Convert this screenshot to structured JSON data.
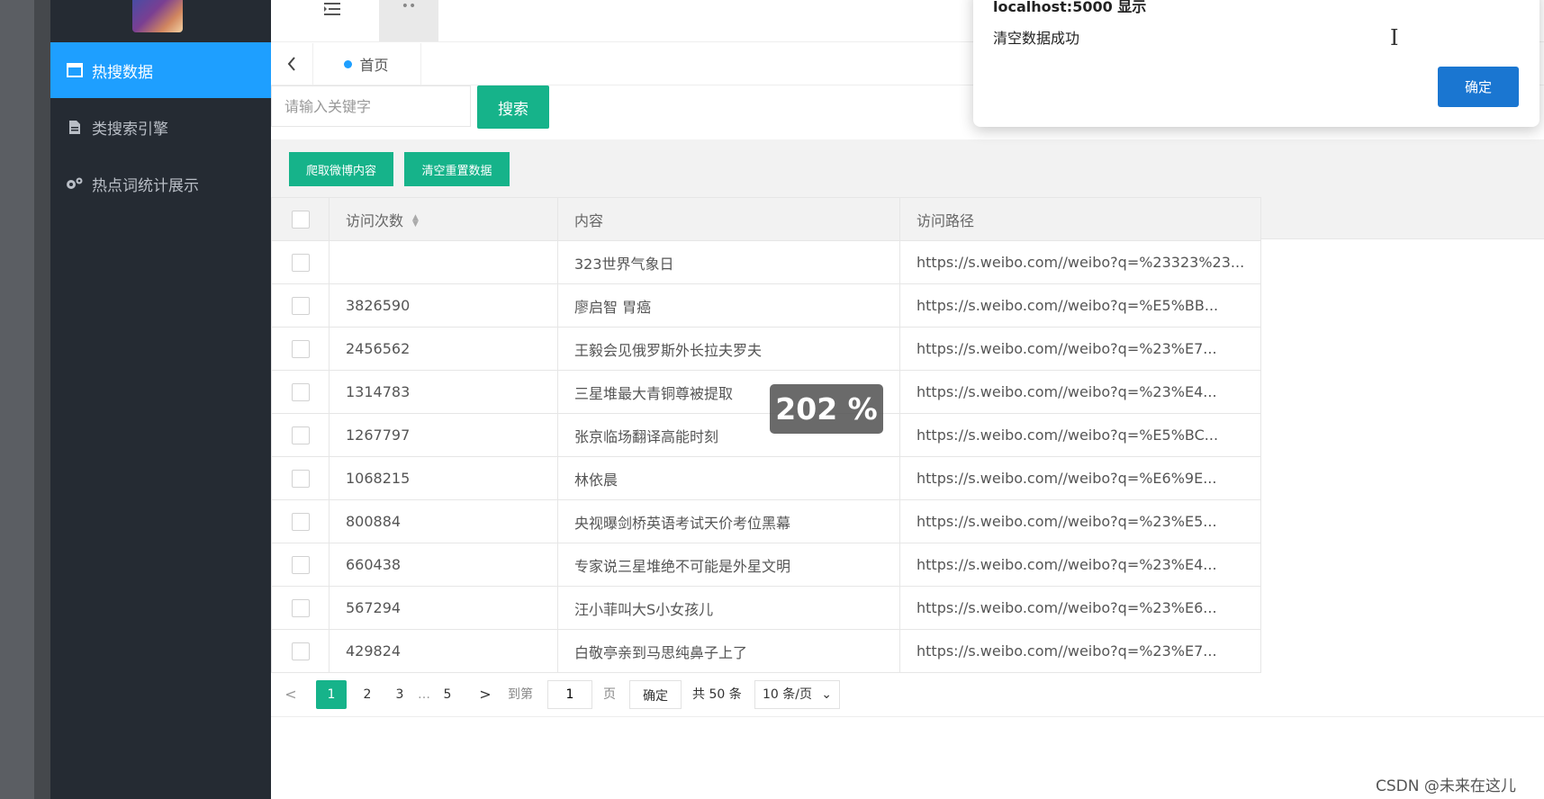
{
  "sidebar": {
    "items": [
      {
        "label": "热搜数据",
        "icon": "window-icon",
        "active": true
      },
      {
        "label": "类搜索引擎",
        "icon": "document-icon",
        "active": false
      },
      {
        "label": "热点词统计展示",
        "icon": "gears-icon",
        "active": false
      }
    ]
  },
  "topbar": {
    "menu_icon": "menu-toggle-icon",
    "tab_dots": "••"
  },
  "tabs": {
    "back_icon": "chevron-left-icon",
    "home_label": "首页"
  },
  "search": {
    "placeholder": "请输入关键字",
    "button": "搜索"
  },
  "toolbar": {
    "crawl_button": "爬取微博内容",
    "clear_button": "清空重置数据"
  },
  "table": {
    "columns": [
      "访问次数",
      "内容",
      "访问路径"
    ],
    "rows": [
      {
        "count": "",
        "content": "323世界气象日",
        "path": "https://s.weibo.com//weibo?q=%23323%23..."
      },
      {
        "count": "3826590",
        "content": "廖启智 胃癌",
        "path": "https://s.weibo.com//weibo?q=%E5%BB..."
      },
      {
        "count": "2456562",
        "content": "王毅会见俄罗斯外长拉夫罗夫",
        "path": "https://s.weibo.com//weibo?q=%23%E7..."
      },
      {
        "count": "1314783",
        "content": "三星堆最大青铜尊被提取",
        "path": "https://s.weibo.com//weibo?q=%23%E4..."
      },
      {
        "count": "1267797",
        "content": "张京临场翻译高能时刻",
        "path": "https://s.weibo.com//weibo?q=%E5%BC..."
      },
      {
        "count": "1068215",
        "content": "林依晨",
        "path": "https://s.weibo.com//weibo?q=%E6%9E..."
      },
      {
        "count": "800884",
        "content": "央视曝剑桥英语考试天价考位黑幕",
        "path": "https://s.weibo.com//weibo?q=%23%E5..."
      },
      {
        "count": "660438",
        "content": "专家说三星堆绝不可能是外星文明",
        "path": "https://s.weibo.com//weibo?q=%23%E4..."
      },
      {
        "count": "567294",
        "content": "汪小菲叫大S小女孩儿",
        "path": "https://s.weibo.com//weibo?q=%23%E6..."
      },
      {
        "count": "429824",
        "content": "白敬亭亲到马思纯鼻子上了",
        "path": "https://s.weibo.com//weibo?q=%23%E7..."
      }
    ]
  },
  "pagination": {
    "prev": "<",
    "pages": [
      "1",
      "2",
      "3"
    ],
    "ellipsis": "…",
    "last": "5",
    "next": ">",
    "goto_label": "到第",
    "goto_value": "1",
    "page_unit": "页",
    "confirm": "确定",
    "total": "共 50 条",
    "page_size": "10 条/页",
    "current_page": 1
  },
  "dialog": {
    "title": "localhost:5000 显示",
    "message": "清空数据成功",
    "ok": "确定"
  },
  "zoom_overlay": "202 %",
  "watermark": "CSDN @未来在这儿",
  "colors": {
    "accent_blue": "#1e9fff",
    "accent_green": "#16b38a",
    "sidebar_bg": "#252b33",
    "dialog_button": "#1a76d1"
  }
}
